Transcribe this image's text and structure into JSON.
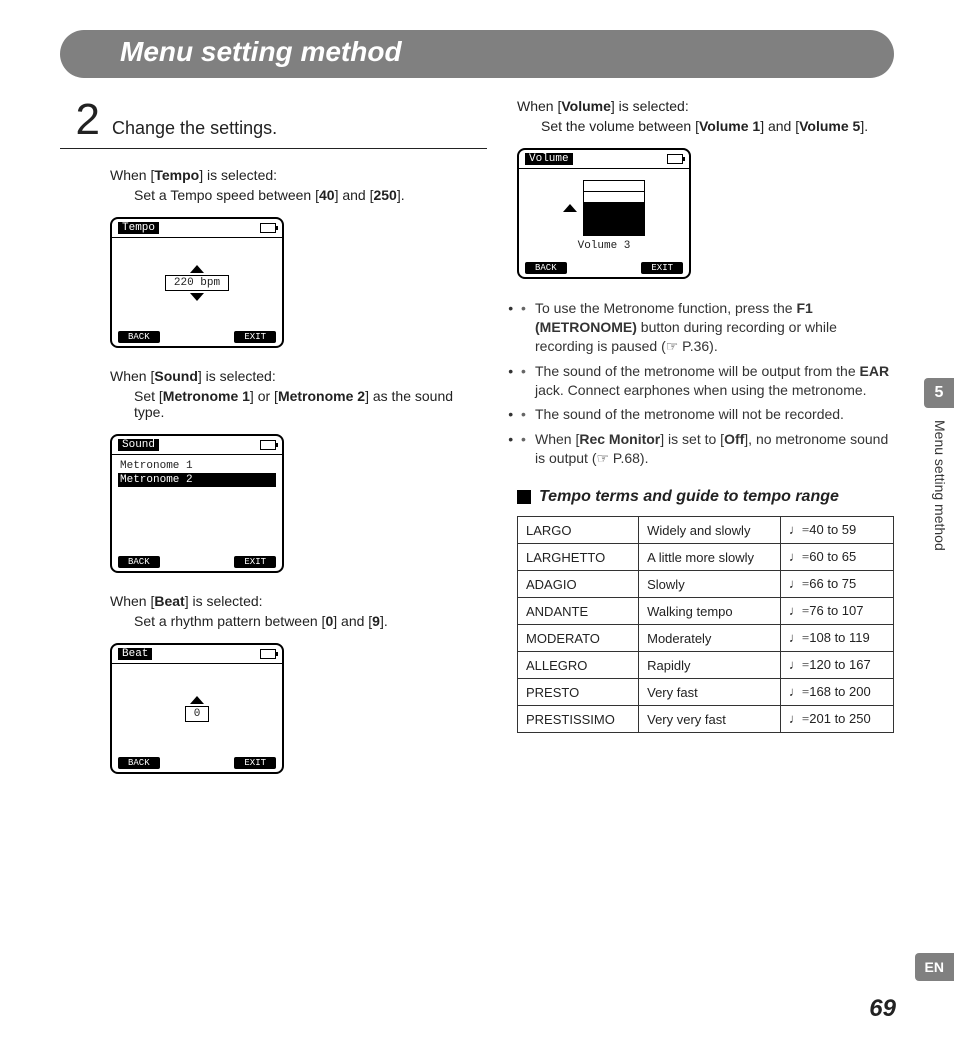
{
  "header": {
    "title": "Menu setting method"
  },
  "sidebar": {
    "chapter": "5",
    "label": "Menu setting method",
    "lang": "EN"
  },
  "page_number": "69",
  "step": {
    "num": "2",
    "title": "Change the settings."
  },
  "left": {
    "tempo": {
      "intro_pre": "When [",
      "intro_bold": "Tempo",
      "intro_post": "] is selected:",
      "body_pre": "Set a Tempo speed between [",
      "b1": "40",
      "mid": "] and [",
      "b2": "250",
      "post": "].",
      "lcd": {
        "title": "Tempo",
        "value": "220 bpm",
        "back": "BACK",
        "exit": "EXIT"
      }
    },
    "sound": {
      "intro_pre": "When [",
      "intro_bold": "Sound",
      "intro_post": "] is selected:",
      "body_pre": "Set [",
      "b1": "Metronome 1",
      "mid": "] or [",
      "b2": "Metronome 2",
      "post": "] as the sound type.",
      "lcd": {
        "title": "Sound",
        "row1": "Metronome 1",
        "row2": "Metronome 2",
        "back": "BACK",
        "exit": "EXIT"
      }
    },
    "beat": {
      "intro_pre": "When [",
      "intro_bold": "Beat",
      "intro_post": "] is selected:",
      "body_pre": "Set a rhythm pattern between [",
      "b1": "0",
      "mid": "] and [",
      "b2": "9",
      "post": "].",
      "lcd": {
        "title": "Beat",
        "value": "0",
        "back": "BACK",
        "exit": "EXIT"
      }
    }
  },
  "right": {
    "volume": {
      "intro_pre": "When [",
      "intro_bold": "Volume",
      "intro_post": "] is selected:",
      "body_pre": "Set the volume between [",
      "b1": "Volume 1",
      "mid": "] and [",
      "b2": "Volume 5",
      "post": "].",
      "lcd": {
        "title": "Volume",
        "caption": "Volume 3",
        "back": "BACK",
        "exit": "EXIT"
      }
    },
    "bullets": {
      "b1_pre": "To use the Metronome function, press the ",
      "b1_bold": "F1 (METRONOME)",
      "b1_post": " button during recording or while recording is paused (☞ P.36).",
      "b2_pre": "The sound of the metronome will be output from the ",
      "b2_bold": "EAR",
      "b2_post": " jack. Connect earphones when using the metronome.",
      "b3": "The sound of the metronome will not be recorded.",
      "b4_pre": "When [",
      "b4_bold": "Rec Monitor",
      "b4_mid": "] is set to [",
      "b4_bold2": "Off",
      "b4_post": "], no metronome sound is output (☞ P.68)."
    },
    "subheading": "Tempo terms and guide to tempo range",
    "note_prefix": "♩=",
    "table": [
      {
        "term": "LARGO",
        "desc": "Widely and slowly",
        "range": "40 to 59"
      },
      {
        "term": "LARGHETTO",
        "desc": "A little more slowly",
        "range": "60 to 65"
      },
      {
        "term": "ADAGIO",
        "desc": "Slowly",
        "range": "66 to 75"
      },
      {
        "term": "ANDANTE",
        "desc": "Walking tempo",
        "range": "76 to 107"
      },
      {
        "term": "MODERATO",
        "desc": "Moderately",
        "range": "108 to 119"
      },
      {
        "term": "ALLEGRO",
        "desc": "Rapidly",
        "range": "120 to 167"
      },
      {
        "term": "PRESTO",
        "desc": "Very fast",
        "range": "168 to 200"
      },
      {
        "term": "PRESTISSIMO",
        "desc": "Very very fast",
        "range": "201 to 250"
      }
    ]
  }
}
